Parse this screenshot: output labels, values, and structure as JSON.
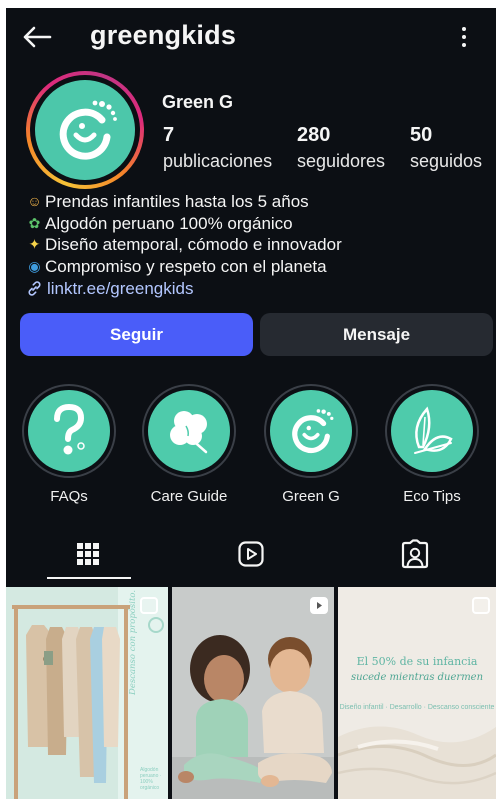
{
  "header": {
    "username": "greengkids",
    "back_icon": "arrow-left-icon",
    "more_icon": "more-vertical-icon"
  },
  "profile": {
    "display_name": "Green G",
    "stats": [
      {
        "value": "7",
        "label": "publicaciones"
      },
      {
        "value": "280",
        "label": "seguidores"
      },
      {
        "value": "50",
        "label": "seguidos"
      }
    ],
    "bio": [
      {
        "emoji": "☺",
        "text": "Prendas infantiles hasta los 5 años"
      },
      {
        "emoji": "✿",
        "text": "Algodón peruano 100% orgánico"
      },
      {
        "emoji": "✦",
        "text": "Diseño atemporal, cómodo e innovador"
      },
      {
        "emoji": "◉",
        "text": "Compromiso y respeto con el planeta"
      }
    ],
    "link": "linktr.ee/greengkids"
  },
  "actions": {
    "follow": "Seguir",
    "message": "Mensaje"
  },
  "highlights": [
    {
      "label": "FAQs",
      "icon": "question-icon"
    },
    {
      "label": "Care Guide",
      "icon": "cotton-plant-icon"
    },
    {
      "label": "Green G",
      "icon": "green-g-logo-icon"
    },
    {
      "label": "Eco Tips",
      "icon": "leaf-icon"
    }
  ],
  "tabs": [
    {
      "name": "grid",
      "icon": "grid-icon"
    },
    {
      "name": "reels",
      "icon": "reels-icon"
    },
    {
      "name": "tagged",
      "icon": "tagged-icon"
    }
  ],
  "posts": [
    {
      "side_text": "Descanso con propósito.",
      "caption": "Algodón peruano · 100% orgánico"
    },
    {},
    {
      "title": "El 50% de su infancia",
      "subtitle": "sucede mientras duermen",
      "tagline": "Diseño infantil · Desarrollo · Descanso consciente"
    }
  ],
  "colors": {
    "background": "#0c0f14",
    "brand": "#4cc7aa",
    "follow_button": "#4a5df9",
    "link": "#b3c7ff"
  }
}
